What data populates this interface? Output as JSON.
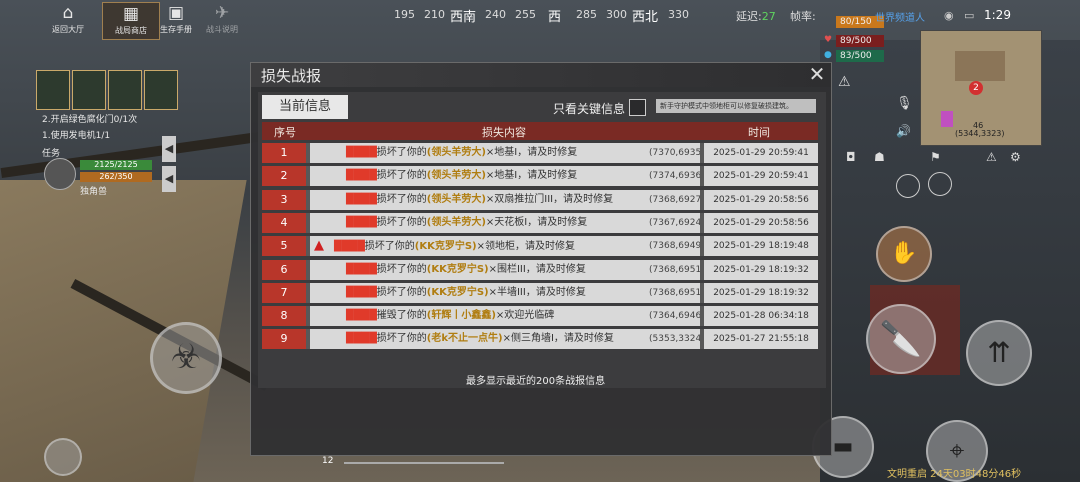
{
  "hud": {
    "buttons": [
      {
        "label": "返回大厅",
        "icon": "home-icon"
      },
      {
        "label": "战局商店",
        "icon": "shop-icon"
      },
      {
        "label": "生存手册",
        "icon": "book-icon"
      },
      {
        "label": "战斗说明",
        "icon": "plane-icon"
      }
    ],
    "compass": [
      {
        "t": "195",
        "dir": false
      },
      {
        "t": "210",
        "dir": false
      },
      {
        "t": "西南",
        "dir": true
      },
      {
        "t": "240",
        "dir": false
      },
      {
        "t": "255",
        "dir": false
      },
      {
        "t": "西",
        "dir": true
      },
      {
        "t": "285",
        "dir": false
      },
      {
        "t": "300",
        "dir": false
      },
      {
        "t": "西北",
        "dir": true
      },
      {
        "t": "330",
        "dir": false
      }
    ],
    "latency_label": "延迟:",
    "latency_value": "27",
    "fps_label": "帧率:",
    "stats": [
      "80/150",
      "89/500",
      "83/500"
    ],
    "system_channel": "世界频道人",
    "time": "1:29"
  },
  "team": {
    "quests": [
      "2.开启绿色腐化门0/1次",
      "1.使用发电机1/1"
    ],
    "task_label": "任务",
    "hp": "2125/2125",
    "mp": "262/350",
    "name": "独角兽"
  },
  "minimap": {
    "coord": "(5344,3323)",
    "level": "46"
  },
  "dialog": {
    "title": "损失战报",
    "tab_current": "当前信息",
    "filter_label": "只看关键信息",
    "tip": "新手守护模式中领地柜可以修复破损建筑。",
    "columns": {
      "no": "序号",
      "content": "损失内容",
      "time": "时间"
    },
    "rows": [
      {
        "no": "1",
        "attacker": "████",
        "verb": "损坏了你的",
        "guild": "(领头羊劳大)",
        "item": "×地基I，请及时修复",
        "pos": "(7370,6935)",
        "time": "2025-01-29 20:59:41",
        "warn": false
      },
      {
        "no": "2",
        "attacker": "████",
        "verb": "损坏了你的",
        "guild": "(领头羊劳大)",
        "item": "×地基I，请及时修复",
        "pos": "(7374,6936)",
        "time": "2025-01-29 20:59:41",
        "warn": false
      },
      {
        "no": "3",
        "attacker": "████",
        "verb": "损坏了你的",
        "guild": "(领头羊劳大)",
        "item": "×双扇推拉门III，请及时修复",
        "pos": "(7368,6927)",
        "time": "2025-01-29 20:58:56",
        "warn": false
      },
      {
        "no": "4",
        "attacker": "████",
        "verb": "损坏了你的",
        "guild": "(领头羊劳大)",
        "item": "×天花板I，请及时修复",
        "pos": "(7367,6924)",
        "time": "2025-01-29 20:58:56",
        "warn": false
      },
      {
        "no": "5",
        "attacker": "████",
        "verb": "损坏了你的",
        "guild": "(KK克罗宁S)",
        "item": "×领地柜，请及时修复",
        "pos": "(7368,6949)",
        "time": "2025-01-29 18:19:48",
        "warn": true
      },
      {
        "no": "6",
        "attacker": "████",
        "verb": "损坏了你的",
        "guild": "(KK克罗宁S)",
        "item": "×围栏III，请及时修复",
        "pos": "(7368,6951)",
        "time": "2025-01-29 18:19:32",
        "warn": false
      },
      {
        "no": "7",
        "attacker": "████",
        "verb": "损坏了你的",
        "guild": "(KK克罗宁S)",
        "item": "×半墙III，请及时修复",
        "pos": "(7368,6951)",
        "time": "2025-01-29 18:19:32",
        "warn": false
      },
      {
        "no": "8",
        "attacker": "████",
        "verb": "摧毁了你的",
        "guild": "(轩辉丨小鑫鑫)",
        "item": "×欢迎光临碑",
        "pos": "(7364,6946)",
        "time": "2025-01-28 06:34:18",
        "warn": false
      },
      {
        "no": "9",
        "attacker": "████",
        "verb": "损坏了你的",
        "guild": "(老k不止一点牛)",
        "item": "×侧三角墙I，请及时修复",
        "pos": "(5353,3324)",
        "time": "2025-01-27 21:55:18",
        "warn": false
      }
    ],
    "footnote": "最多显示最近的200条战报信息"
  },
  "bottom": {
    "ammo": "12",
    "footer": "文明重启 24天03时48分46秒"
  }
}
